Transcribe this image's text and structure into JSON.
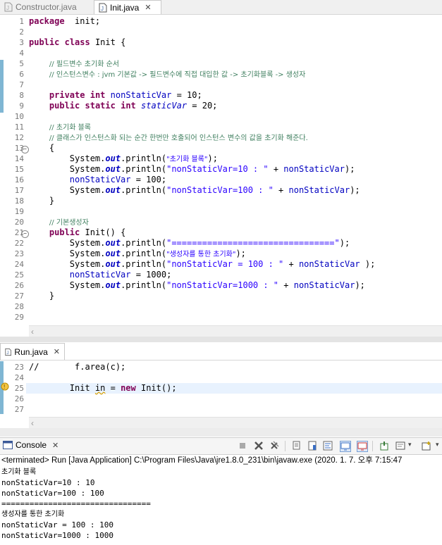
{
  "top_tabs": [
    {
      "label": "Constructor.java"
    },
    {
      "label": "Init.java"
    }
  ],
  "init_editor": {
    "lines": [
      {
        "n": "1",
        "segs": [
          [
            "kw",
            "package"
          ],
          [
            "",
            "  init;"
          ]
        ]
      },
      {
        "n": "2",
        "segs": []
      },
      {
        "n": "3",
        "segs": [
          [
            "kw",
            "public"
          ],
          [
            "",
            " "
          ],
          [
            "kw",
            "class"
          ],
          [
            "",
            " Init {"
          ]
        ]
      },
      {
        "n": "4",
        "segs": []
      },
      {
        "n": "5",
        "segs": [
          [
            "",
            "    "
          ],
          [
            "cm",
            "// 필드변수 초기화 순서"
          ]
        ]
      },
      {
        "n": "6",
        "segs": [
          [
            "",
            "    "
          ],
          [
            "cm",
            "// 인스턴스변수 : jvm 기본값 -> 필드변수에 직접 대입한 값 -> 초기화블록 -> 생성자"
          ]
        ]
      },
      {
        "n": "7",
        "segs": []
      },
      {
        "n": "8",
        "segs": [
          [
            "",
            "    "
          ],
          [
            "kw",
            "private"
          ],
          [
            "",
            " "
          ],
          [
            "kw",
            "int"
          ],
          [
            "",
            " "
          ],
          [
            "fld",
            "nonStaticVar"
          ],
          [
            "",
            " = 10;"
          ]
        ]
      },
      {
        "n": "9",
        "segs": [
          [
            "",
            "    "
          ],
          [
            "kw",
            "public"
          ],
          [
            "",
            " "
          ],
          [
            "kw",
            "static"
          ],
          [
            "",
            " "
          ],
          [
            "kw",
            "int"
          ],
          [
            "",
            " "
          ],
          [
            "st",
            "staticVar"
          ],
          [
            "",
            " = 20;"
          ]
        ]
      },
      {
        "n": "10",
        "segs": []
      },
      {
        "n": "11",
        "segs": [
          [
            "",
            "    "
          ],
          [
            "cm",
            "// 초기화 블록"
          ]
        ]
      },
      {
        "n": "12",
        "segs": [
          [
            "",
            "    "
          ],
          [
            "cm",
            "// 클래스가 인스턴스화 되는 순간 한번만 호출되어 인스턴스 변수의 값을 초기화 해준다."
          ]
        ]
      },
      {
        "n": "13",
        "segs": [
          [
            "",
            "    {"
          ]
        ]
      },
      {
        "n": "14",
        "segs": [
          [
            "",
            "        System."
          ],
          [
            "io",
            "out"
          ],
          [
            "",
            ".println("
          ],
          [
            "str",
            "\"초기화 블록\""
          ],
          [
            "",
            ");"
          ]
        ]
      },
      {
        "n": "15",
        "segs": [
          [
            "",
            "        System."
          ],
          [
            "io",
            "out"
          ],
          [
            "",
            ".println("
          ],
          [
            "str",
            "\"nonStaticVar=10 : \""
          ],
          [
            "",
            " + "
          ],
          [
            "fld",
            "nonStaticVar"
          ],
          [
            "",
            ");"
          ]
        ]
      },
      {
        "n": "16",
        "segs": [
          [
            "",
            "        "
          ],
          [
            "fld",
            "nonStaticVar"
          ],
          [
            "",
            " = 100;"
          ]
        ]
      },
      {
        "n": "17",
        "segs": [
          [
            "",
            "        System."
          ],
          [
            "io",
            "out"
          ],
          [
            "",
            ".println("
          ],
          [
            "str",
            "\"nonStaticVar=100 : \""
          ],
          [
            "",
            " + "
          ],
          [
            "fld",
            "nonStaticVar"
          ],
          [
            "",
            ");"
          ]
        ]
      },
      {
        "n": "18",
        "segs": [
          [
            "",
            "    }"
          ]
        ]
      },
      {
        "n": "19",
        "segs": []
      },
      {
        "n": "20",
        "segs": [
          [
            "",
            "    "
          ],
          [
            "cm",
            "// 기본생성자"
          ]
        ]
      },
      {
        "n": "21",
        "segs": [
          [
            "",
            "    "
          ],
          [
            "kw",
            "public"
          ],
          [
            "",
            " Init() {"
          ]
        ]
      },
      {
        "n": "22",
        "segs": [
          [
            "",
            "        System."
          ],
          [
            "io",
            "out"
          ],
          [
            "",
            ".println("
          ],
          [
            "str",
            "\"================================\""
          ],
          [
            "",
            ");"
          ]
        ]
      },
      {
        "n": "23",
        "segs": [
          [
            "",
            "        System."
          ],
          [
            "io",
            "out"
          ],
          [
            "",
            ".println("
          ],
          [
            "str",
            "\"생성자를 통한 초기화\""
          ],
          [
            "",
            ");"
          ]
        ]
      },
      {
        "n": "24",
        "segs": [
          [
            "",
            "        System."
          ],
          [
            "io",
            "out"
          ],
          [
            "",
            ".println("
          ],
          [
            "str",
            "\"nonStaticVar = 100 : \""
          ],
          [
            "",
            " + "
          ],
          [
            "fld",
            "nonStaticVar"
          ],
          [
            "",
            " );"
          ]
        ]
      },
      {
        "n": "25",
        "segs": [
          [
            "",
            "        "
          ],
          [
            "fld",
            "nonStaticVar"
          ],
          [
            "",
            " = 1000;"
          ]
        ]
      },
      {
        "n": "26",
        "segs": [
          [
            "",
            "        System."
          ],
          [
            "io",
            "out"
          ],
          [
            "",
            ".println("
          ],
          [
            "str",
            "\"nonStaticVar=1000 : \""
          ],
          [
            "",
            " + "
          ],
          [
            "fld",
            "nonStaticVar"
          ],
          [
            "",
            ");"
          ]
        ]
      },
      {
        "n": "27",
        "segs": [
          [
            "",
            "    }"
          ]
        ]
      },
      {
        "n": "28",
        "segs": []
      },
      {
        "n": "29",
        "segs": []
      }
    ]
  },
  "run_tab": {
    "label": "Run.java"
  },
  "run_editor": {
    "lines": [
      {
        "n": "23",
        "segs": [
          [
            "",
            "//       f.area(c);"
          ]
        ]
      },
      {
        "n": "24",
        "segs": []
      },
      {
        "n": "25",
        "segs": [
          [
            "",
            "        Init "
          ],
          [
            "squig",
            "in"
          ],
          [
            "",
            " = "
          ],
          [
            "kw",
            "new"
          ],
          [
            "",
            " Init();"
          ]
        ]
      },
      {
        "n": "26",
        "segs": []
      },
      {
        "n": "27",
        "segs": []
      }
    ]
  },
  "console": {
    "tab_label": "Console",
    "status": "<terminated> Run [Java Application] C:\\Program Files\\Java\\jre1.8.0_231\\bin\\javaw.exe (2020. 1. 7. 오후 7:15:47",
    "output": [
      "초기화 블록",
      "nonStaticVar=10 : 10",
      "nonStaticVar=100 : 100",
      "================================",
      "생성자를 통한 초기화",
      "nonStaticVar = 100 : 100",
      "nonStaticVar=1000 : 1000"
    ]
  },
  "colors": {
    "keyword": "#7f0055",
    "comment": "#3f7f5f",
    "field": "#0000c0",
    "string": "#2a00ff",
    "current_line": "#e8f2fe"
  },
  "icons": [
    "java-file-icon",
    "close-icon",
    "console-icon",
    "terminate-icon",
    "remove-launch-icon",
    "clear-console-icon",
    "scroll-lock-icon",
    "pin-console-icon",
    "display-console-icon",
    "open-console-icon"
  ]
}
